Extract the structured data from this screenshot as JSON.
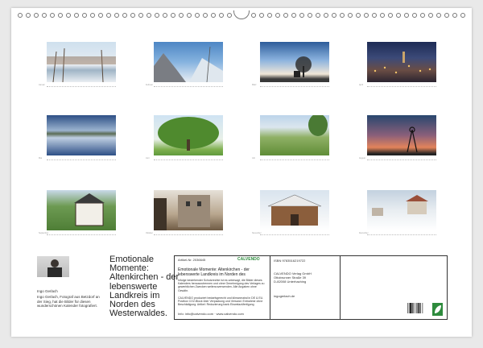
{
  "thumbs": [
    {
      "caption": "Januar"
    },
    {
      "caption": "Februar"
    },
    {
      "caption": "März"
    },
    {
      "caption": "April"
    },
    {
      "caption": "Mai"
    },
    {
      "caption": "Juni"
    },
    {
      "caption": "Juli"
    },
    {
      "caption": "August"
    },
    {
      "caption": "September"
    },
    {
      "caption": "Oktober"
    },
    {
      "caption": "November"
    },
    {
      "caption": "Dezember"
    }
  ],
  "title": "Emotionale Momente: Altenkirchen - der lebenswerte Landkreis im Norden des Westerwaldes.",
  "author": {
    "name": "Ingo Gerlach",
    "bio": "Ingo Gerlach, Fotograf aus Betzdorf an der Sieg, hat die Bilder für diesen wunderschönen Kalender fotografiert."
  },
  "info": {
    "article_no": "Artikel-Nr. 2036645",
    "brand": "CALVENDO",
    "box_title": "Emotionale Momente: Altenkirchen - der lebenswerte Landkreis im Norden des Westerwaldes.",
    "legal": "Infolge bestehender Schutzrechte ist es untersagt, die Bilder dieses Kalenders herauszutrennen und ohne Genehmigung des Verlages zu gewerblichen Zwecken weiterzuverwenden. Alle Angaben ohne Gewähr.",
    "eco": "CALVENDO produziert bedarfsgerecht und klimaneutral in DE & EU. Postbox CO2-Block über Verpackung und Versand. Entnahme ohne Beschädigung. Artikel: Reduzierung bank Einwelazüfertigung",
    "contact": "Info: info@calvendo.com · www.calvendo.com",
    "isbn": "ISBN 9783516219722",
    "publisher_lines": [
      "CALVENDO Verlag GmbH",
      "Ottobrunner Straße 39",
      "D-82008 Unterhaching"
    ],
    "website": "ingogerlach.de"
  }
}
